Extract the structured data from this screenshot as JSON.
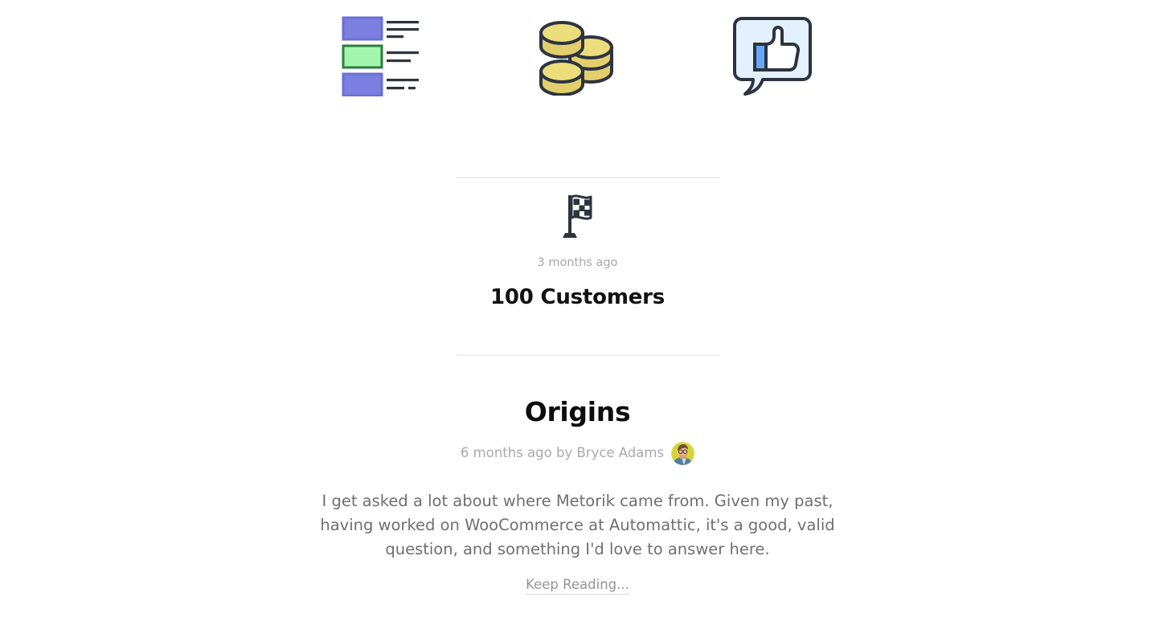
{
  "header_icons": [
    {
      "name": "report-list-icon",
      "alt": "Reports list icon"
    },
    {
      "name": "coins-icon",
      "alt": "Coins icon"
    },
    {
      "name": "thumbs-up-bubble-icon",
      "alt": "Thumbs up speech bubble icon"
    }
  ],
  "milestone": {
    "icon_name": "checkered-flag-icon",
    "date": "3 months ago",
    "title": "100 Customers"
  },
  "post": {
    "title": "Origins",
    "meta_text": "6 months ago by Bryce Adams",
    "author": "Bryce Adams",
    "avatar_name": "author-avatar",
    "excerpt": "I get asked a lot about where Metorik came from. Given my past, having worked on WooCommerce at Automattic, it's a good, valid question, and something I'd love to answer here.",
    "keep_reading_label": "Keep Reading..."
  },
  "colors": {
    "background": "#ffffff",
    "divider": "#eeeeef",
    "muted_text": "#a9a9a9",
    "body_text": "#6f6f6f",
    "heading_text": "#0d0d0d",
    "link_text": "#93959a",
    "icon_outline": "#2c3440",
    "icon_purple": "#7b7fe0",
    "icon_green": "#a2f5ad",
    "icon_gold": "#ecdd7b",
    "icon_bubble": "#e3f0fd",
    "icon_blue": "#67a7f5",
    "avatar_bg": "#d7d438"
  }
}
